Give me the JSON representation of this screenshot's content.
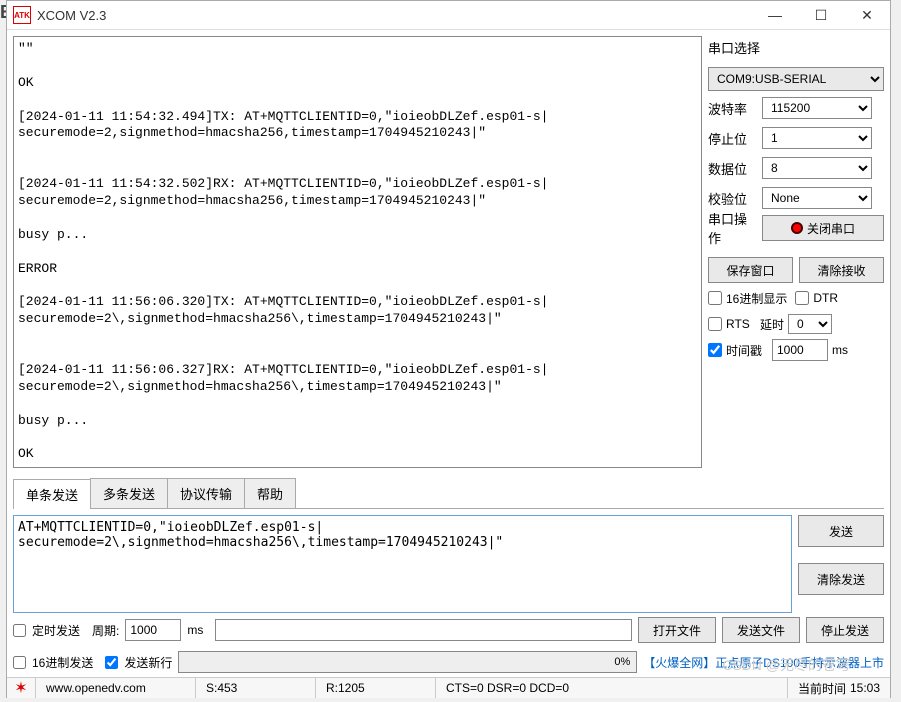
{
  "title": "XCOM V2.3",
  "rx_log": "\"\"\n\nOK\n\n[2024-01-11 11:54:32.494]TX: AT+MQTTCLIENTID=0,\"ioieobDLZef.esp01-s|\nsecuremode=2,signmethod=hmacsha256,timestamp=1704945210243|\"\n\n\n[2024-01-11 11:54:32.502]RX: AT+MQTTCLIENTID=0,\"ioieobDLZef.esp01-s|\nsecuremode=2,signmethod=hmacsha256,timestamp=1704945210243|\"\n\nbusy p...\n\nERROR\n\n[2024-01-11 11:56:06.320]TX: AT+MQTTCLIENTID=0,\"ioieobDLZef.esp01-s|\nsecuremode=2\\,signmethod=hmacsha256\\,timestamp=1704945210243|\"\n\n\n[2024-01-11 11:56:06.327]RX: AT+MQTTCLIENTID=0,\"ioieobDLZef.esp01-s|\nsecuremode=2\\,signmethod=hmacsha256\\,timestamp=1704945210243|\"\n\nbusy p...\n\nOK\n",
  "serial": {
    "title": "串口选择",
    "port": "COM9:USB-SERIAL",
    "baud_label": "波特率",
    "baud": "115200",
    "stop_label": "停止位",
    "stop": "1",
    "data_label": "数据位",
    "data": "8",
    "parity_label": "校验位",
    "parity": "None",
    "op_label": "串口操作",
    "op_btn": "关闭串口",
    "save_window": "保存窗口",
    "clear_rx": "清除接收",
    "hex_disp": "16进制显示",
    "dtr": "DTR",
    "rts": "RTS",
    "delay_label": "延时",
    "delay_val": "0",
    "delay_unit": "",
    "timestamp": "时间戳",
    "ts_val": "1000",
    "ts_unit": "ms"
  },
  "tabs": [
    "单条发送",
    "多条发送",
    "协议传输",
    "帮助"
  ],
  "send": {
    "text": "AT+MQTTCLIENTID=0,\"ioieobDLZef.esp01-s|\nsecuremode=2\\,signmethod=hmacsha256\\,timestamp=1704945210243|\"",
    "send_btn": "发送",
    "clear_send": "清除发送"
  },
  "opts": {
    "timed_send": "定时发送",
    "period_label": "周期:",
    "period_val": "1000",
    "period_unit": "ms",
    "open_file": "打开文件",
    "send_file": "发送文件",
    "stop_send": "停止发送",
    "hex_send": "16进制发送",
    "send_newline": "发送新行",
    "progress": "0%",
    "promo": "【火爆全网】正点原子DS100手持示波器上市"
  },
  "status": {
    "url": "www.openedv.com",
    "s": "S:453",
    "r": "R:1205",
    "lines": "CTS=0 DSR=0 DCD=0",
    "time_label": "当前时间",
    "time_val": "15:03"
  },
  "watermark": "CSDN @无尽的苍穹"
}
